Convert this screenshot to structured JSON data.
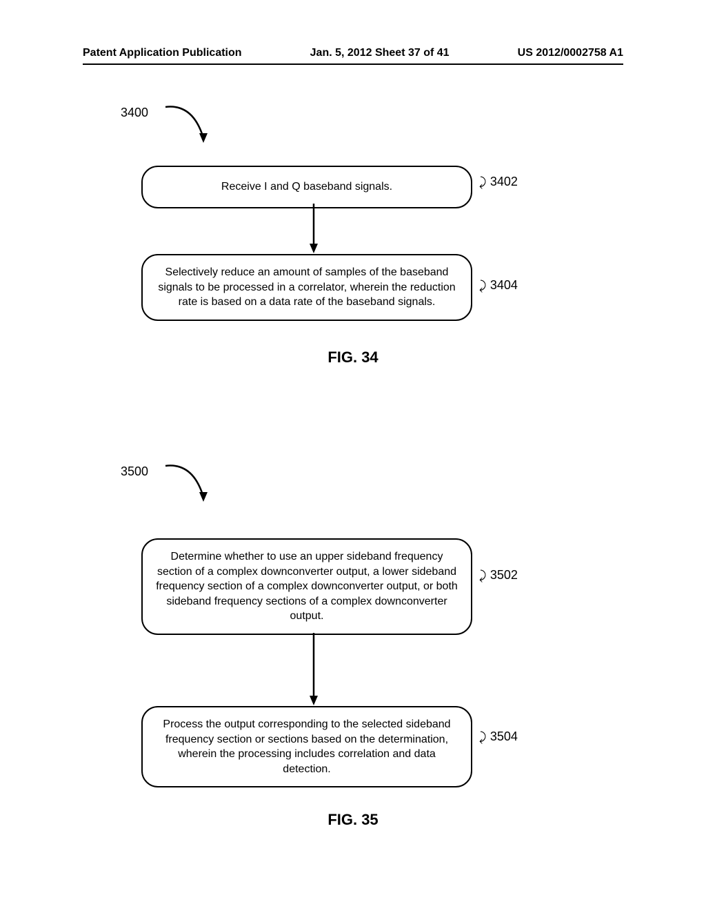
{
  "header": {
    "left": "Patent Application Publication",
    "center": "Jan. 5, 2012  Sheet 37 of 41",
    "right": "US 2012/0002758 A1"
  },
  "fig34": {
    "ref": "3400",
    "box1": {
      "text": "Receive I and Q baseband signals.",
      "label": "3402"
    },
    "box2": {
      "text": "Selectively reduce an amount of samples of the baseband signals to be processed in a correlator, wherein the reduction rate is based on a data rate of the baseband signals.",
      "label": "3404"
    },
    "caption": "FIG. 34"
  },
  "fig35": {
    "ref": "3500",
    "box1": {
      "text": "Determine whether to use an upper sideband frequency section of a complex downconverter output, a lower sideband frequency section of a complex downconverter output, or both sideband frequency sections of a complex downconverter output.",
      "label": "3502"
    },
    "box2": {
      "text": "Process the output corresponding to the selected sideband frequency section or sections based on the determination, wherein the processing includes correlation and data detection.",
      "label": "3504"
    },
    "caption": "FIG. 35"
  }
}
